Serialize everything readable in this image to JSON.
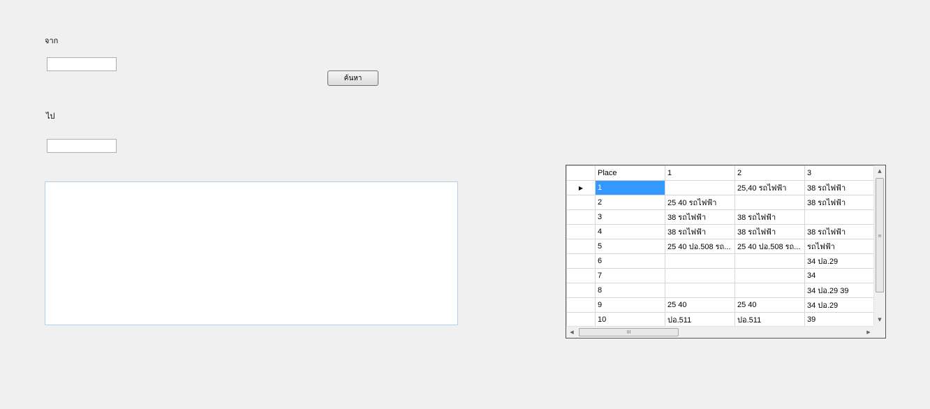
{
  "form": {
    "from_label": "จาก",
    "from_value": "",
    "to_label": "ไป",
    "to_value": "",
    "search_button": "ค้นหา",
    "result_text": ""
  },
  "grid": {
    "columns": [
      "Place",
      "1",
      "2",
      "3"
    ],
    "current_row_marker": "▶",
    "rows": [
      [
        "1",
        "",
        "25,40 รถไฟฟ้า",
        "38 รถไฟฟ้า"
      ],
      [
        "2",
        "25 40 รถไฟฟ้า",
        "",
        "38 รถไฟฟ้า"
      ],
      [
        "3",
        "38 รถไฟฟ้า",
        "38 รถไฟฟ้า",
        ""
      ],
      [
        "4",
        "38 รถไฟฟ้า",
        "38 รถไฟฟ้า",
        "38 รถไฟฟ้า"
      ],
      [
        "5",
        "25 40 ปอ.508 รถ...",
        "25 40 ปอ.508 รถ...",
        "รถไฟฟ้า"
      ],
      [
        "6",
        "",
        "",
        "34 ปอ.29"
      ],
      [
        "7",
        "",
        "",
        "34"
      ],
      [
        "8",
        "",
        "",
        "34 ปอ.29 39"
      ],
      [
        "9",
        "25 40",
        "25 40",
        "34 ปอ.29"
      ],
      [
        "10",
        "ปอ.511",
        "ปอ.511",
        "39"
      ]
    ],
    "scroll": {
      "up_arrow": "▲",
      "down_arrow": "▼",
      "left_arrow": "◀",
      "right_arrow": "▶",
      "thumb_grip_v": "≡",
      "thumb_grip_h": "III"
    }
  }
}
